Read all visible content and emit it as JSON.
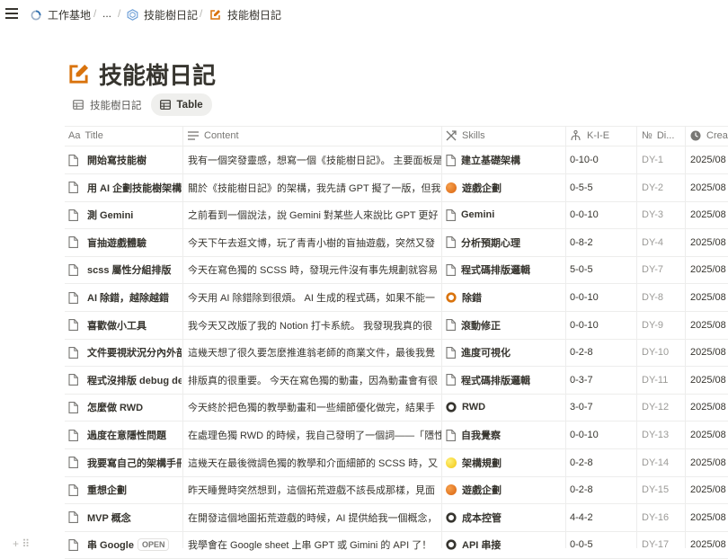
{
  "breadcrumb": [
    {
      "label": "工作基地",
      "icon": "loading-circle-icon"
    },
    {
      "label": "..."
    },
    {
      "label": "技能樹日記",
      "icon": "hexagon-icon"
    },
    {
      "label": "技能樹日記",
      "icon": "edit-note-icon"
    }
  ],
  "page": {
    "title": "技能樹日記",
    "icon": "edit-note-icon"
  },
  "views": [
    {
      "label": "技能樹日記",
      "icon": "table-icon",
      "active": false
    },
    {
      "label": "Table",
      "icon": "table-icon",
      "active": true
    }
  ],
  "columns": {
    "title": "Title",
    "content": "Content",
    "skills": "Skills",
    "kie": "K-I-E",
    "di": "Di...",
    "created": "Crea"
  },
  "rows": [
    {
      "title": "開始寫技能樹",
      "content": "我有一個突發靈感，想寫一個《技能樹日記》。 主要面板是",
      "skill": "建立基礎架構",
      "skill_icon": "page-icon",
      "kie": "0-10-0",
      "di": "DY-1",
      "date": "2025/08"
    },
    {
      "title": "用 AI 企劃技能樹架構",
      "content": "關於《技能樹日記》的架構，我先請 GPT 擬了一版，但我",
      "skill": "遊戲企劃",
      "skill_icon": "orange-circle-icon",
      "kie": "0-5-5",
      "di": "DY-2",
      "date": "2025/08"
    },
    {
      "title": "測 Gemini",
      "content": "之前看到一個說法，說 Gemini 對某些人來說比 GPT 更好",
      "skill": "Gemini",
      "skill_icon": "page-icon",
      "kie": "0-0-10",
      "di": "DY-3",
      "date": "2025/08"
    },
    {
      "title": "盲抽遊戲體驗",
      "content": "今天下午去逛文博，玩了青青小樹的盲抽遊戲，突然又發",
      "skill": "分析預期心理",
      "skill_icon": "page-icon",
      "kie": "0-8-2",
      "di": "DY-4",
      "date": "2025/08"
    },
    {
      "title": "scss 屬性分組排版",
      "content": "今天在寫色獨的 SCSS 時，發現元件沒有事先規劃就容易",
      "skill": "程式碼排版邏輯",
      "skill_icon": "page-icon",
      "kie": "5-0-5",
      "di": "DY-7",
      "date": "2025/08"
    },
    {
      "title": "AI 除錯，越除越錯",
      "content": "今天用 AI 除錯除到很煩。 AI 生成的程式碼，如果不能一",
      "skill": "除錯",
      "skill_icon": "orange-ring-icon",
      "kie": "0-0-10",
      "di": "DY-8",
      "date": "2025/08"
    },
    {
      "title": "喜歡做小工具",
      "content": "我今天又改版了我的 Notion 打卡系統。 我發現我真的很",
      "skill": "滾動修正",
      "skill_icon": "page-icon",
      "kie": "0-0-10",
      "di": "DY-9",
      "date": "2025/08"
    },
    {
      "title": "文件要視狀況分內外部",
      "content": "這幾天想了很久要怎麼推進翁老師的商業文件，最後我覺",
      "skill": "進度可視化",
      "skill_icon": "page-icon",
      "kie": "0-2-8",
      "di": "DY-10",
      "date": "2025/08"
    },
    {
      "title": "程式沒排版 debug de",
      "content": "排版真的很重要。 今天在寫色獨的動畫，因為動畫會有很",
      "skill": "程式碼排版邏輯",
      "skill_icon": "page-icon",
      "kie": "0-3-7",
      "di": "DY-11",
      "date": "2025/08"
    },
    {
      "title": "怎麼做 RWD",
      "content": "今天終於把色獨的教學動畫和一些細節優化做完，結果手",
      "skill": "RWD",
      "skill_icon": "dark-ring-icon",
      "kie": "3-0-7",
      "di": "DY-12",
      "date": "2025/08"
    },
    {
      "title": "過度在意隱性問題",
      "content": "在處理色獨 RWD 的時候，我自己發明了一個詞——「隱性",
      "skill": "自我覺察",
      "skill_icon": "page-icon",
      "kie": "0-0-10",
      "di": "DY-13",
      "date": "2025/08"
    },
    {
      "title": "我要寫自己的架構手冊",
      "content": "這幾天在最後微調色獨的教學和介面細節的 SCSS 時，又",
      "skill": "架構規劃",
      "skill_icon": "yellow-circle-icon",
      "kie": "0-2-8",
      "di": "DY-14",
      "date": "2025/08"
    },
    {
      "title": "重想企劃",
      "content": "昨天睡覺時突然想到，這個拓荒遊戲不該長成那樣，見面",
      "skill": "遊戲企劃",
      "skill_icon": "orange-circle-icon",
      "kie": "0-2-8",
      "di": "DY-15",
      "date": "2025/08"
    },
    {
      "title": "MVP 概念",
      "content": "在開發這個地圖拓荒遊戲的時候，AI 提供給我一個概念，",
      "skill": "成本控管",
      "skill_icon": "dark-ring-icon",
      "kie": "4-4-2",
      "di": "DY-16",
      "date": "2025/08"
    },
    {
      "title": "串 Google",
      "content": "我學會在 Google sheet 上串 GPT 或 Gimini 的 API 了！",
      "skill": "API 串接",
      "skill_icon": "dark-ring-icon",
      "kie": "0-0-5",
      "di": "DY-17",
      "date": "2025/08",
      "open": "OPEN"
    }
  ],
  "colors": {
    "accent_orange": "#d9730d",
    "text": "#37352f",
    "muted": "#9b9a97",
    "grid": "#ededec",
    "active_view_bg": "#efefed"
  }
}
